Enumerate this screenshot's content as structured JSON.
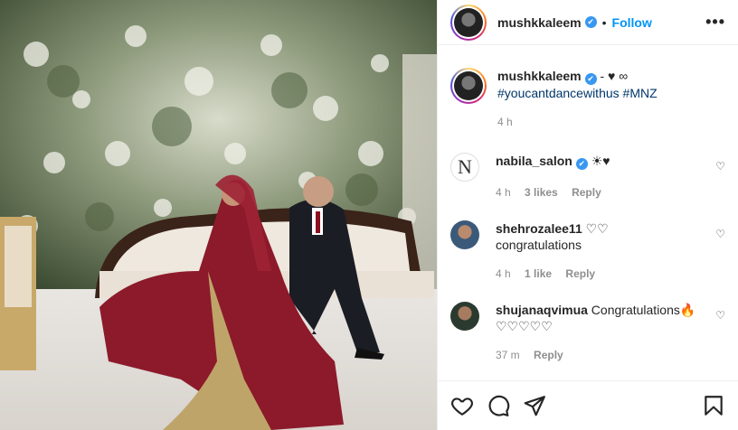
{
  "header": {
    "username": "mushkkaleem",
    "verified_badge": "✔",
    "separator": "•",
    "follow_label": "Follow",
    "more_label": "•••"
  },
  "caption": {
    "username": "mushkkaleem",
    "text": " - ♥ ∞",
    "hashtags": "#youcantdancewithus #MNZ",
    "time": "4 h"
  },
  "comments": [
    {
      "username": "nabila_salon",
      "text": " ☀♥",
      "time": "4 h",
      "likes": "3 likes",
      "reply": "Reply",
      "verified": true,
      "avatar_letter": "N"
    },
    {
      "username": "shehrozalee11",
      "text": " ♡♡",
      "line2": "congratulations",
      "time": "4 h",
      "likes": "1 like",
      "reply": "Reply",
      "verified": false
    },
    {
      "username": "shujanaqvimua",
      "text": " Congratulations🔥",
      "line2": "♡♡♡♡♡",
      "time": "37 m",
      "likes": "",
      "reply": "Reply",
      "verified": false
    }
  ],
  "icons": {
    "like": "heart-icon",
    "comment": "comment-icon",
    "share": "share-icon",
    "save": "bookmark-icon"
  },
  "colors": {
    "follow_blue": "#0095f6",
    "verified_blue": "#3897f0",
    "hashtag": "#00376b",
    "meta_gray": "#8e8e8e"
  }
}
